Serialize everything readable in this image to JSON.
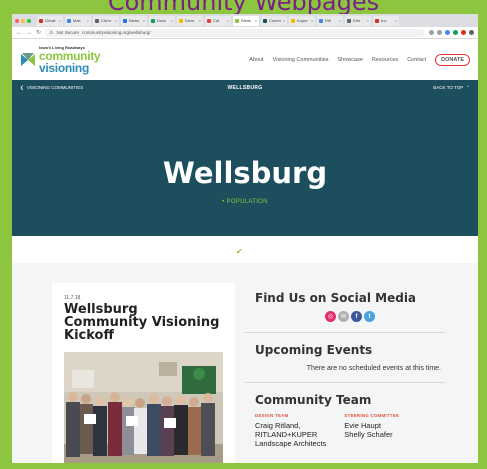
{
  "slide_heading": "Community Webpages",
  "browser": {
    "tabs": [
      {
        "label": "Gmail",
        "color": "#d93025",
        "active": false
      },
      {
        "label": "Mail",
        "color": "#4285f4",
        "active": false
      },
      {
        "label": "Chrm",
        "color": "#5f6368",
        "active": false
      },
      {
        "label": "News",
        "color": "#1a73e8",
        "active": false
      },
      {
        "label": "Docs",
        "color": "#0f9d58",
        "active": false
      },
      {
        "label": "Drive",
        "color": "#f4b400",
        "active": false
      },
      {
        "label": "Cal",
        "color": "#db4437",
        "active": false
      },
      {
        "label": "Wells",
        "color": "#8cc63f",
        "active": true
      },
      {
        "label": "Comm",
        "color": "#1c4e5d",
        "active": false
      },
      {
        "label": "Kuper",
        "color": "#f4b400",
        "active": false
      },
      {
        "label": "Ritl",
        "color": "#4285f4",
        "active": false
      },
      {
        "label": "Erie",
        "color": "#5f6368",
        "active": false
      },
      {
        "label": "Inc",
        "color": "#d93025",
        "active": false
      }
    ],
    "url": "communityvisioning.org/wellsburg/",
    "security_label": "Not Secure",
    "window_dots": [
      "#ff5f57",
      "#febc2e",
      "#28c840"
    ],
    "extensions": [
      "#9aa0a6",
      "#9aa0a6",
      "#4285f4",
      "#0f9d58",
      "#d93025",
      "#5f6368"
    ]
  },
  "site": {
    "logo_small": "Iowa's Living Roadways",
    "logo_line1": "community",
    "logo_line2": "visioning",
    "nav": [
      "About",
      "Visioning Communities",
      "Showcase",
      "Resources",
      "Contact"
    ],
    "donate_label": "DONATE"
  },
  "subheader": {
    "back_label": "VISIONING COMMUNITIES",
    "title": "WELLSBURG",
    "top_label": "BACK TO TOP"
  },
  "hero": {
    "title": "Wellsburg",
    "subtitle": "• POPULATION"
  },
  "card": {
    "date": "11.7.18",
    "title": "Wellsburg Community Visioning Kickoff"
  },
  "sidebar": {
    "social_title": "Find Us on Social Media",
    "social": [
      {
        "name": "instagram-icon",
        "glyph": "◎",
        "color": "#e1306c"
      },
      {
        "name": "email-icon",
        "glyph": "✉",
        "color": "#b0b0b0"
      },
      {
        "name": "facebook-icon",
        "glyph": "f",
        "color": "#3b5998"
      },
      {
        "name": "twitter-icon",
        "glyph": "t",
        "color": "#4aa3df"
      }
    ],
    "events_title": "Upcoming Events",
    "events_text": "There are no scheduled events at this time.",
    "team_title": "Community Team",
    "design_team_header": "DESIGN TEAM",
    "design_team": [
      "Craig Ritland,",
      "RITLAND+KUPER",
      "Landscape Architects"
    ],
    "steering_header": "STEERING COMMITTEE",
    "steering": [
      "Evie Haupt",
      "Shelly Schafer"
    ]
  }
}
